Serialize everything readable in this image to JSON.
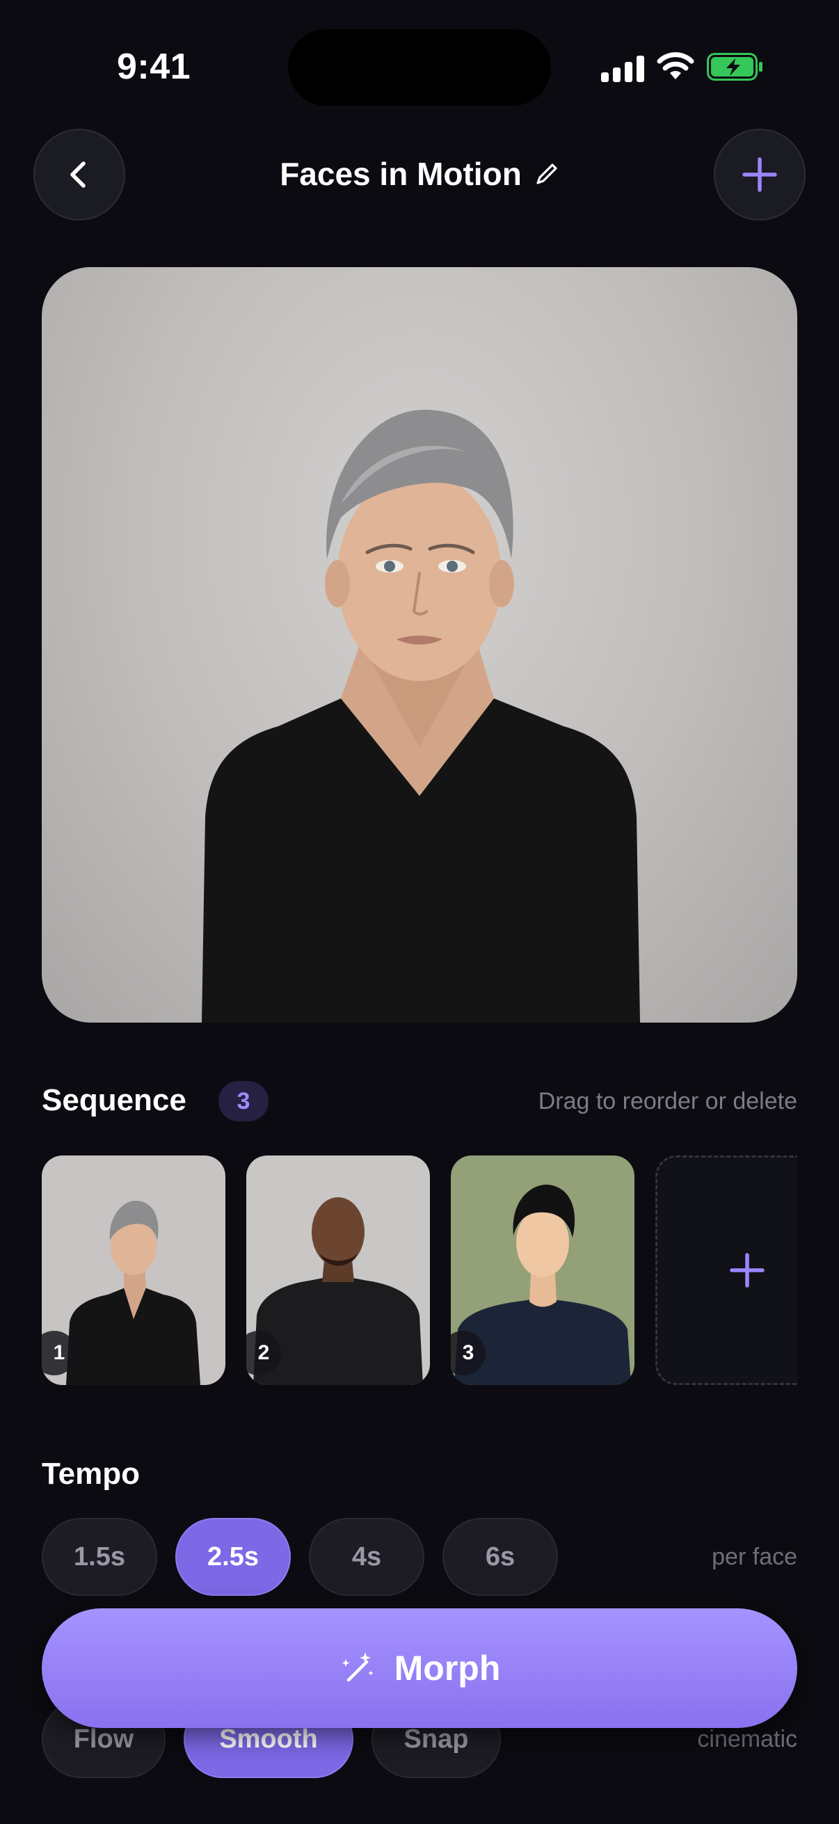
{
  "status_bar": {
    "time": "9:41"
  },
  "header": {
    "title": "Faces in Motion"
  },
  "sequence": {
    "label": "Sequence",
    "count": "3",
    "hint": "Drag to reorder or delete",
    "items": [
      {
        "index": "1"
      },
      {
        "index": "2"
      },
      {
        "index": "3"
      }
    ]
  },
  "tempo": {
    "label": "Tempo",
    "options": [
      "1.5s",
      "2.5s",
      "4s",
      "6s"
    ],
    "selected": "2.5s",
    "unit": "per face"
  },
  "style": {
    "options": [
      "Flow",
      "Smooth",
      "Snap"
    ],
    "selected": "Smooth",
    "unit": "cinematic"
  },
  "cta": {
    "label": "Morph"
  },
  "colors": {
    "background": "#0c0b11",
    "accent": "#8a71ee",
    "accent_text": "#9d8cff",
    "battery_green": "#34c759"
  }
}
